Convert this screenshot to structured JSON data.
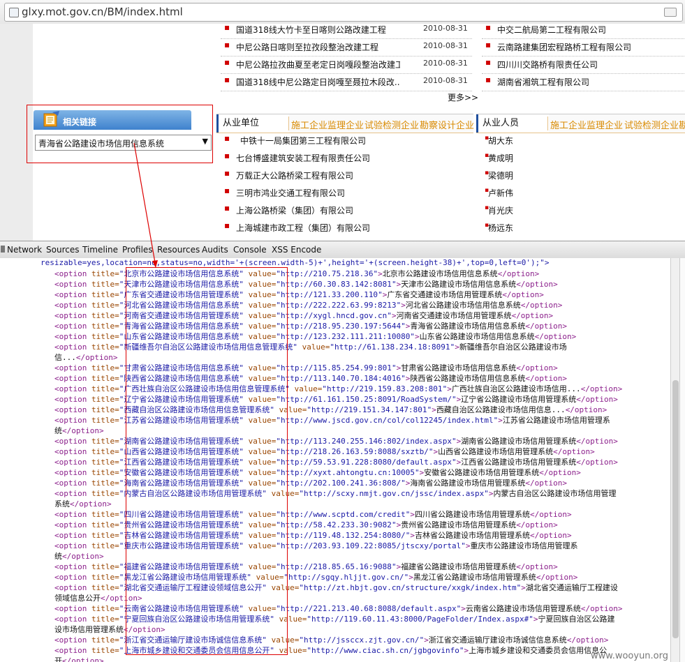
{
  "browser": {
    "url": "glxy.mot.gov.cn/BM/index.html"
  },
  "news": [
    {
      "title": "国道318线大竹卡至日喀则公路改建工程",
      "date": "2010-08-31"
    },
    {
      "title": "中尼公路日喀则至拉孜段整治改建工程",
      "date": "2010-08-31"
    },
    {
      "title": "中尼公路拉孜曲夏至老定日岗嘎段整治改建工...",
      "date": "2010-08-31"
    },
    {
      "title": "国道318线中尼公路定日岗嘎至聂拉木段改...",
      "date": "2010-08-31"
    }
  ],
  "right_companies": [
    "中交二航局第二工程有限公司",
    "云南路建集团宏程路桥工程有限公司",
    "四川川交路桥有限责任公司",
    "湖南省湘筑工程有限公司"
  ],
  "more_label": "更多>>",
  "related": {
    "title": "相关链接",
    "selected": "青海省公路建设市场信用信息系统",
    "arrow": "▼"
  },
  "unit_tabs": {
    "active": "从业单位",
    "tabs": [
      "施工企业",
      "监理企业",
      "试验检测企业",
      "勘察设计企业"
    ]
  },
  "person_tabs": {
    "active": "从业人员",
    "tabs": [
      "施工企业",
      "监理企业",
      "试验检测企业",
      "勘"
    ]
  },
  "units": [
    "中铁十一局集团第三工程有限公司",
    "七台博盛建筑安装工程有限责任公司",
    "万载正大公路桥梁工程有限公司",
    "三明市鸿业交通工程有限公司",
    "上海公路桥梁（集团）有限公司",
    "上海城建市政工程（集团）有限公司"
  ],
  "persons": [
    "胡大东",
    "黄成明",
    "梁德明",
    "卢新伟",
    "肖光庆",
    "杨远东"
  ],
  "devtools": {
    "tabs": [
      "Network",
      "Sources",
      "Timeline",
      "Profiles",
      "Resources",
      "Audits",
      "Console",
      "XSS Encode"
    ]
  },
  "code": {
    "topline": "resizable=yes,location=no,status=no,width='+(screen.width-5)+',height='+(screen.height-38)+',top=0,left=0');\">",
    "lines": [
      {
        "title": "北京市公路建设市场信用信息系统",
        "value": "http://210.75.218.36",
        "text": "北京市公路建设市场信用信息系统",
        "close": true
      },
      {
        "title": "天津市公路建设市场信用信息系统",
        "value": "http://60.30.83.142:8081",
        "text": "天津市公路建设市场信用信息系统",
        "close": true
      },
      {
        "title": "广东省交通建设市场信用管理系统",
        "value": "http://121.33.200.110",
        "text": "广东省交通建设市场信用管理系统",
        "close": true
      },
      {
        "title": "河北省公路建设市场信用信息系统",
        "value": "http://222.222.63.99:8213",
        "text": "河北省公路建设市场信用信息系统",
        "close": true
      },
      {
        "title": "河南省交通建设市场信用管理系统",
        "value": "http://xygl.hncd.gov.cn",
        "text": "河南省交通建设市场信用管理系统",
        "close": true
      },
      {
        "title": "青海省公路建设市场信用信息系统",
        "value": "http://218.95.230.197:5644",
        "text": "青海省公路建设市场信用信息系统",
        "close": true
      },
      {
        "title": "山东省公路建设市场信用信息系统",
        "value": "http://123.232.111.211:10080",
        "text": "山东省公路建设市场信用信息系统",
        "close": true
      },
      {
        "title": "新疆维吾尔自治区公路建设市场信用信息管理系统",
        "value": "http://61.138.234.18:8091",
        "text": "新疆维吾尔自治区公路建设市场",
        "cont": "信...",
        "close": true
      },
      {
        "title": "甘肃省公路建设市场信用信息系统",
        "value": "http://115.85.254.99:801",
        "text": "甘肃省公路建设市场信用信息系统",
        "close": true
      },
      {
        "title": "陕西省公路建设市场信用信息系统",
        "value": "http://113.140.70.184:4016",
        "text": "陕西省公路建设市场信用信息系统",
        "close": true
      },
      {
        "title": "广西壮族自治区公路建设市场信用信息管理系统",
        "value": "http://219.159.83.208:801",
        "text": "广西壮族自治区公路建设市场信用...",
        "close": true
      },
      {
        "title": "辽宁省公路建设市场信用管理系统",
        "value": "http://61.161.150.25:8091/RoadSystem/",
        "text": "辽宁省公路建设市场信用管理系统",
        "close": true
      },
      {
        "title": "西藏自治区公路建设市场信用信息管理系统",
        "value": "http://219.151.34.147:801",
        "text": "西藏自治区公路建设市场信用信息...",
        "close": true
      },
      {
        "title": "江苏省公路建设市场信用管理系统",
        "value": "http://www.jscd.gov.cn/col/col12245/index.html",
        "text": "江苏省公路建设市场信用管理系",
        "cont": "统",
        "close": true
      },
      {
        "title": "湖南省公路建设市场信用管理系统",
        "value": "http://113.240.255.146:802/index.aspx",
        "text": "湖南省公路建设市场信用管理系统",
        "close": true
      },
      {
        "title": "山西省公路建设市场信用管理系统",
        "value": "http://218.26.163.59:8088/sxztb/",
        "text": "山西省公路建设市场信用管理系统",
        "close": true
      },
      {
        "title": "江西省公路建设市场信用管理系统",
        "value": "http://59.53.91.228:8080/default.aspx",
        "text": "江西省公路建设市场信用管理系统",
        "close": true
      },
      {
        "title": "安徽省公路建设市场信用管理系统",
        "value": "http://xyxt.ahtongtu.cn:10005",
        "text": "安徽省公路建设市场信用管理系统",
        "close": true
      },
      {
        "title": "海南省公路建设市场信用管理系统",
        "value": "http://202.100.241.36:808/",
        "text": "海南省公路建设市场信用管理系统",
        "close": true
      },
      {
        "title": "内蒙古自治区公路建设市场信用管理系统",
        "value": "http://scxy.nmjt.gov.cn/jssc/index.aspx",
        "text": "内蒙古自治区公路建设市场信用管理",
        "cont": "系统",
        "close": true
      },
      {
        "title": "四川省公路建设市场信用管理系统",
        "value": "http://www.scptd.com/credit",
        "text": "四川省公路建设市场信用管理系统",
        "close": true
      },
      {
        "title": "贵州省公路建设市场信用管理系统",
        "value": "http://58.42.233.30:9082",
        "text": "贵州省公路建设市场信用管理系统",
        "close": true
      },
      {
        "title": "吉林省公路建设市场信用管理系统",
        "value": "http://119.48.132.254:8080/",
        "text": "吉林省公路建设市场信用管理系统",
        "close": true
      },
      {
        "title": "重庆市公路建设市场信用管理系统",
        "value": "http://203.93.109.22:8085/jtscxy/portal",
        "text": "重庆市公路建设市场信用管理系",
        "cont": "统",
        "close": true
      },
      {
        "title": "福建省公路建设市场信用管理系统",
        "value": "http://218.85.65.16:9088",
        "text": "福建省公路建设市场信用管理系统",
        "close": true
      },
      {
        "title": "黑龙江省公路建设市场信用管理系统",
        "value": "http://sgqy.hljjt.gov.cn/",
        "text": "黑龙江省公路建设市场信用管理系统",
        "close": true
      },
      {
        "title": "湖北省交通运输厅工程建设领域信息公开",
        "value": "http://zt.hbjt.gov.cn/structure/xxgk/index.htm",
        "text": "湖北省交通运输厅工程建设",
        "cont": "领域信息公开",
        "close": true
      },
      {
        "title": "云南省公路建设市场信用管理系统",
        "value": "http://221.213.40.68:8088/default.aspx",
        "text": "云南省公路建设市场信用管理系统",
        "close": true
      },
      {
        "title": "宁夏回族自治区公路建设市场信用管理系统",
        "value": "http://119.60.11.43:8000/PageFolder/Index.aspx#",
        "text": "宁夏回族自治区公路建",
        "cont": "设市场信用管理系统",
        "close": true
      },
      {
        "title": "浙江省交通运输厅建设市场诚信信息系统",
        "value": "http://jssccx.zjt.gov.cn/",
        "text": "浙江省交通运输厅建设市场诚信信息系统",
        "close": true
      },
      {
        "title": "上海市城乡建设和交通委员会信用信息公开",
        "value": "http://www.ciac.sh.cn/jgbgovinfo",
        "text": "上海市城乡建设和交通委员会信用信息公",
        "cont": "开",
        "close": true
      }
    ]
  },
  "watermark": "www.wooyun.org",
  "colors": {
    "highlight": "#dd0000",
    "bullet": "#d00000",
    "tab_orange": "#d98a00"
  }
}
